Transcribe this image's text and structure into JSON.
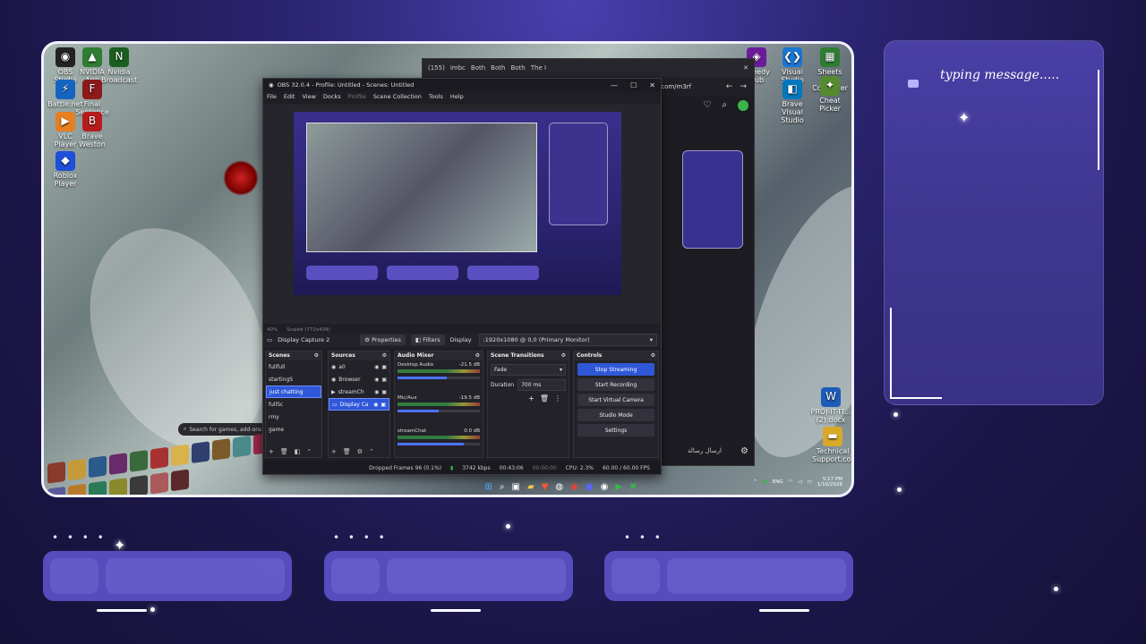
{
  "chat": {
    "typing_message": "typing message....."
  },
  "browser": {
    "tabs": [
      "(155)",
      "imbc",
      "Both",
      "Both",
      "Both",
      "The I"
    ],
    "url_fragment": ".com/m3rf",
    "chat_placeholder": "ارسال رسالة"
  },
  "desktop_icons": [
    {
      "label": "OBS Studio",
      "color": "#222",
      "glyph": "◉"
    },
    {
      "label": "NVIDIA App",
      "color": "#2e7d32",
      "glyph": "▲"
    },
    {
      "label": "Nvidia Broadcast",
      "color": "#1b5e20",
      "glyph": "N"
    },
    {
      "label": "Battle.net",
      "color": "#1565c0",
      "glyph": "⚡"
    },
    {
      "label": "Final Sentence",
      "color": "#8b1a1a",
      "glyph": "F"
    },
    {
      "label": "VLC Player",
      "color": "#e67e22",
      "glyph": "▶"
    },
    {
      "label": "Brave Weston",
      "color": "#b71c1c",
      "glyph": "B"
    },
    {
      "label": "Roblox Player",
      "color": "#1e4fd8",
      "glyph": "◆"
    }
  ],
  "desktop_icons_right": [
    {
      "label": "Speedy Hub",
      "color": "#6a1b9a",
      "glyph": "◈"
    },
    {
      "label": "Visual Studio Code",
      "color": "#1976d2",
      "glyph": "❮❯"
    },
    {
      "label": "Sheets Chat Converter",
      "color": "#2e7d32",
      "glyph": "▦"
    },
    {
      "label": "Brave Visual Studio",
      "color": "#0277bd",
      "glyph": "◧"
    },
    {
      "label": "Cheat Picker",
      "color": "#558b2f",
      "glyph": "✦"
    }
  ],
  "desktop_files": [
    {
      "label": "PROJ-IT-IT... (2).docx",
      "glyph": "W",
      "color": "#1e5bb8"
    },
    {
      "label": "Technical Support.co...",
      "glyph": "▬",
      "color": "#d9a928"
    }
  ],
  "obs": {
    "title": "OBS 32.0.4 - Profile: Untitled - Scenes: Untitled",
    "menu": [
      "File",
      "Edit",
      "View",
      "Docks",
      "Profile",
      "Scene Collection",
      "Tools",
      "Help"
    ],
    "preview_zoom": "40%",
    "preview_scale": "Scaled (772x434)",
    "source_name": "Display Capture 2",
    "properties_label": "Properties",
    "filters_label": "Filters",
    "display_label": "Display",
    "display_value": ":1920x1080 @ 0,0 (Primary Monitor)",
    "docks": {
      "scenes": {
        "title": "Scenes",
        "items": [
          "fullfull",
          "startingS",
          "just chatting",
          "fullSc",
          "rmy",
          "game"
        ],
        "active_index": 2
      },
      "sources": {
        "title": "Sources",
        "items": [
          "a0",
          "Browser",
          "streamCh",
          "Display Ca"
        ]
      },
      "mixer": {
        "title": "Audio Mixer",
        "tracks": [
          {
            "name": "Desktop Audio",
            "db": "-21.5 dB",
            "level": 0.6
          },
          {
            "name": "Mic/Aux",
            "db": "-19.5 dB",
            "level": 0.5
          },
          {
            "name": "streamChat",
            "db": "0.0 dB",
            "level": 0.8
          }
        ]
      },
      "transitions": {
        "title": "Scene Transitions",
        "type": "Fade",
        "duration_label": "Duration",
        "duration_value": "700 ms"
      },
      "controls": {
        "title": "Controls",
        "stop_streaming": "Stop Streaming",
        "start_recording": "Start Recording",
        "start_virtual_camera": "Start Virtual Camera",
        "studio_mode": "Studio Mode",
        "settings": "Settings"
      }
    },
    "status": {
      "dropped_frames": "Dropped Frames 96 (0.1%)",
      "bitrate": "3742 kbps",
      "stream_time": "00:43:06",
      "rec_time": "00:00:00",
      "cpu": "CPU: 2.3%",
      "fps": "60.00 / 60.00 FPS"
    }
  },
  "game_search_placeholder": "Search for games, add-ons...",
  "tray": {
    "lang": "ENG",
    "time": "5:17 PM",
    "date": "1/10/2026"
  }
}
